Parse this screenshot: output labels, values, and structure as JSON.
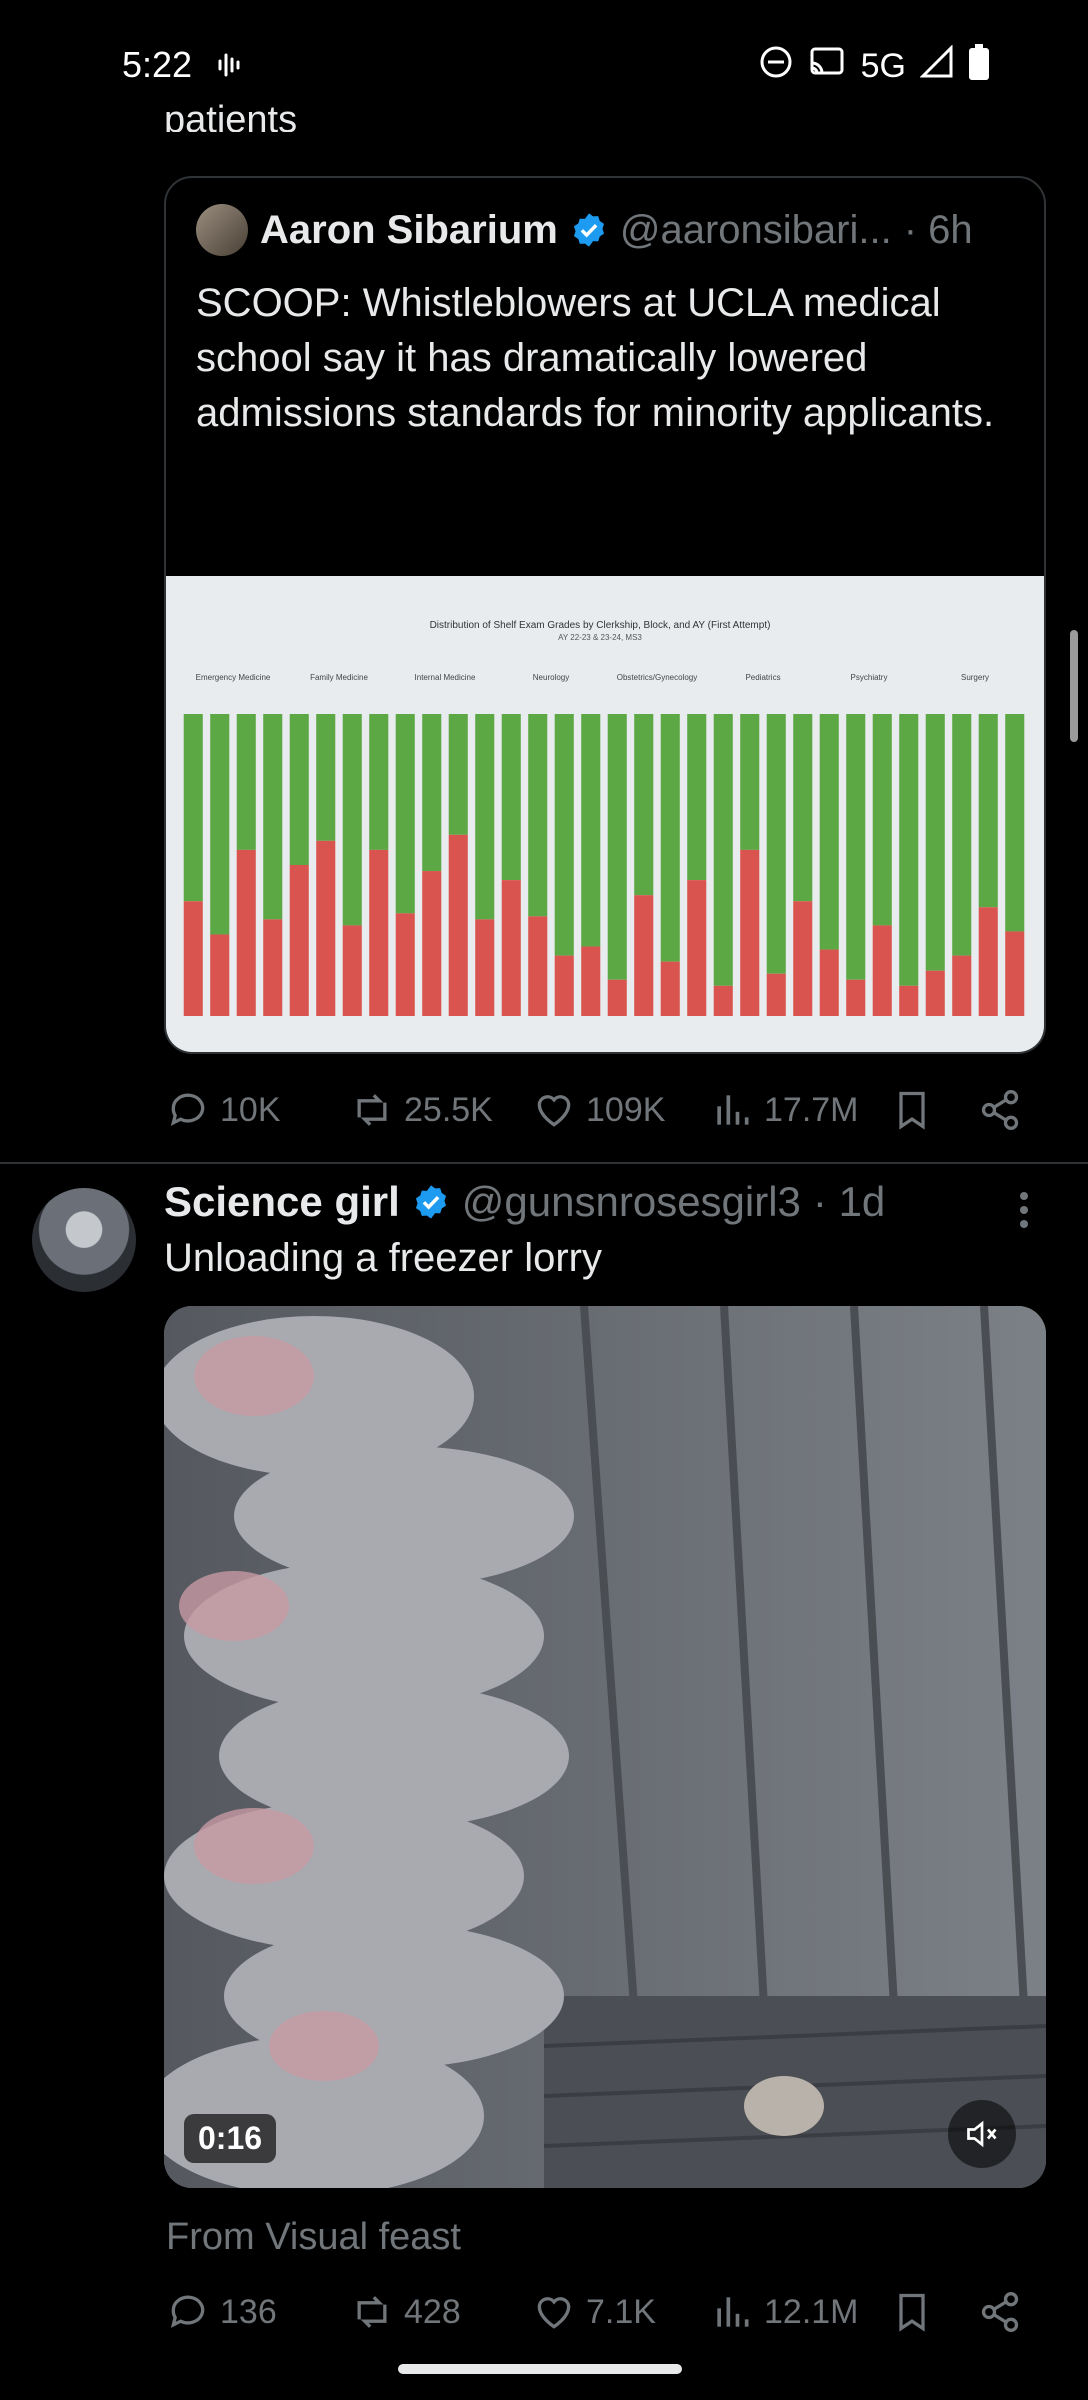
{
  "status_bar": {
    "time": "5:22",
    "network": "5G"
  },
  "partial_text": "patients",
  "quoted_tweet": {
    "name": "Aaron Sibarium",
    "handle": "@aaronsibari...",
    "time": "· 6h",
    "text": "SCOOP: Whistleblowers at UCLA medical school say it has dramatically lowered admissions standards for minority applicants.",
    "more": "...",
    "chart_title": "Distribution of Shelf Exam Grades by Clerkship, Block, and AY (First Attempt)",
    "chart_subtitle": "AY 22-23 & 23-24, MS3",
    "clerkships": [
      "Emergency Medicine",
      "Family Medicine",
      "Internal Medicine",
      "Neurology",
      "Obstetrics/Gynecology",
      "Pediatrics",
      "Psychiatry",
      "Surgery"
    ],
    "stats": {
      "replies": "10K",
      "reposts": "25.5K",
      "likes": "109K",
      "views": "17.7M"
    }
  },
  "tweet": {
    "name": "Science girl",
    "handle": "@gunsnrosesgirl3",
    "time": "· 1d",
    "text": "Unloading a freezer lorry",
    "video_time": "0:16",
    "from": "From Visual feast",
    "stats": {
      "replies": "136",
      "reposts": "428",
      "likes": "7.1K",
      "views": "12.1M"
    }
  },
  "colors": {
    "background": "#000000",
    "muted": "#71767b",
    "verified": "#1d9bf0",
    "border": "#2f3336",
    "chart_green": "#5ca845",
    "chart_red": "#d9544e"
  },
  "chart_data": {
    "type": "bar",
    "stacked": true,
    "title": "Distribution of Shelf Exam Grades by Clerkship, Block, and AY (First Attempt)",
    "series": [
      {
        "name": "",
        "color": "#d9544e",
        "values": [
          0.38,
          0.27,
          0.55,
          0.32,
          0.5,
          0.58,
          0.3,
          0.55,
          0.34,
          0.48,
          0.6,
          0.32,
          0.45,
          0.33,
          0.2,
          0.23,
          0.12,
          0.4,
          0.18,
          0.45,
          0.1,
          0.55,
          0.14,
          0.38,
          0.22,
          0.12,
          0.3,
          0.1,
          0.15,
          0.2,
          0.36,
          0.28
        ]
      },
      {
        "name": "",
        "color": "#5ca845",
        "values": [
          0.62,
          0.73,
          0.45,
          0.68,
          0.5,
          0.42,
          0.7,
          0.45,
          0.66,
          0.52,
          0.4,
          0.68,
          0.55,
          0.67,
          0.8,
          0.77,
          0.88,
          0.6,
          0.82,
          0.55,
          0.9,
          0.45,
          0.86,
          0.62,
          0.78,
          0.88,
          0.7,
          0.9,
          0.85,
          0.8,
          0.64,
          0.72
        ]
      }
    ]
  }
}
